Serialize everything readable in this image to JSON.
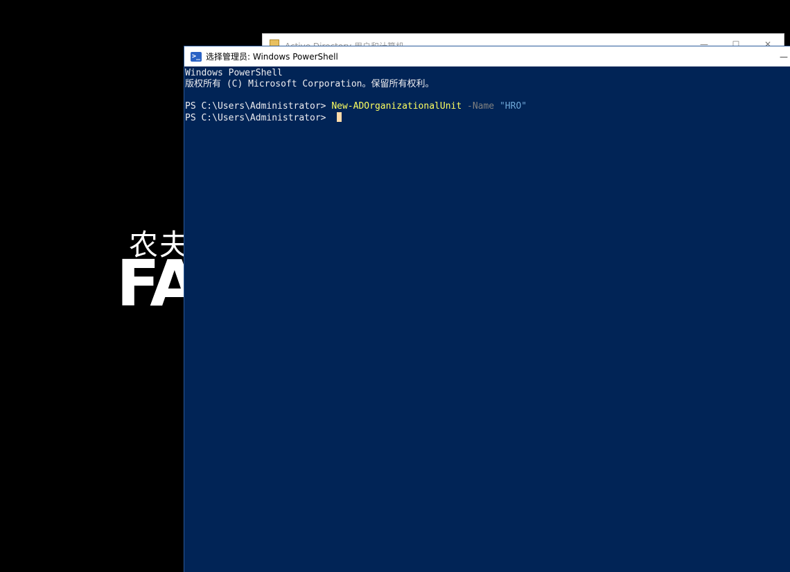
{
  "desktop": {
    "brand_cn": "农夫",
    "brand_en": "FA"
  },
  "ad_window": {
    "title": "Active Directory 用户和计算机",
    "controls": {
      "minimize": "—",
      "maximize": "☐",
      "close": "✕"
    }
  },
  "powershell": {
    "title": "选择管理员: Windows PowerShell",
    "icon_glyph": ">_",
    "header_line1": "Windows PowerShell",
    "header_line2": "版权所有 (C) Microsoft Corporation。保留所有权利。",
    "prompt1": "PS C:\\Users\\Administrator> ",
    "cmdlet": "New-ADOrganizationalUnit",
    "param": "-Name",
    "arg": "\"HRO\"",
    "prompt2": "PS C:\\Users\\Administrator> ",
    "colors": {
      "background": "#012456",
      "text": "#eeedf0",
      "cmdlet": "#ffff60",
      "param": "#808080",
      "string": "#6fa7d8",
      "cursor": "#fedba9"
    }
  }
}
